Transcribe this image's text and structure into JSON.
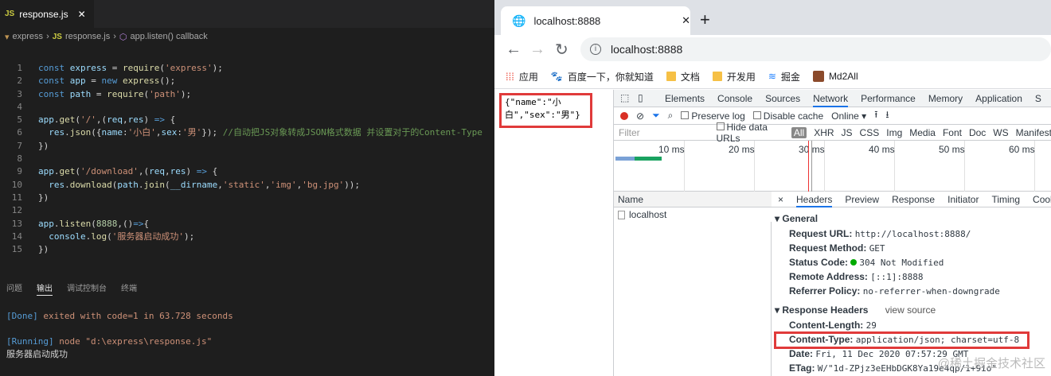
{
  "vscode": {
    "tab_label": "response.js",
    "breadcrumb": [
      "express",
      "response.js",
      "app.listen() callback"
    ],
    "code_lines": [
      {
        "n": "1",
        "html": [
          [
            "kw",
            "const "
          ],
          [
            "var",
            "express"
          ],
          [
            "pl",
            " = "
          ],
          [
            "fn",
            "require"
          ],
          [
            "pl",
            "("
          ],
          [
            "str",
            "'express'"
          ],
          [
            "pl",
            ");"
          ]
        ]
      },
      {
        "n": "2",
        "html": [
          [
            "kw",
            "const "
          ],
          [
            "var",
            "app"
          ],
          [
            "pl",
            " = "
          ],
          [
            "kw",
            "new "
          ],
          [
            "fn",
            "express"
          ],
          [
            "pl",
            "();"
          ]
        ]
      },
      {
        "n": "3",
        "html": [
          [
            "kw",
            "const "
          ],
          [
            "var",
            "path"
          ],
          [
            "pl",
            " = "
          ],
          [
            "fn",
            "require"
          ],
          [
            "pl",
            "("
          ],
          [
            "str",
            "'path'"
          ],
          [
            "pl",
            ");"
          ]
        ]
      },
      {
        "n": "4",
        "html": []
      },
      {
        "n": "5",
        "html": [
          [
            "var",
            "app"
          ],
          [
            "pl",
            "."
          ],
          [
            "fn",
            "get"
          ],
          [
            "pl",
            "("
          ],
          [
            "str",
            "'/'"
          ],
          [
            "pl",
            ",("
          ],
          [
            "var",
            "req"
          ],
          [
            "pl",
            ","
          ],
          [
            "var",
            "res"
          ],
          [
            "pl",
            ") "
          ],
          [
            "kw",
            "=>"
          ],
          [
            "pl",
            " {"
          ]
        ]
      },
      {
        "n": "6",
        "html": [
          [
            "pl",
            "  "
          ],
          [
            "var",
            "res"
          ],
          [
            "pl",
            "."
          ],
          [
            "fn",
            "json"
          ],
          [
            "pl",
            "({"
          ],
          [
            "var",
            "name"
          ],
          [
            "pl",
            ":"
          ],
          [
            "str",
            "'小白'"
          ],
          [
            "pl",
            ","
          ],
          [
            "var",
            "sex"
          ],
          [
            "pl",
            ":"
          ],
          [
            "str",
            "'男'"
          ],
          [
            "pl",
            "}); "
          ],
          [
            "cm",
            "//自动把JS对象转成JSON格式数据 并设置对于的Content-Type"
          ]
        ]
      },
      {
        "n": "7",
        "html": [
          [
            "pl",
            "})"
          ]
        ]
      },
      {
        "n": "8",
        "html": []
      },
      {
        "n": "9",
        "html": [
          [
            "var",
            "app"
          ],
          [
            "pl",
            "."
          ],
          [
            "fn",
            "get"
          ],
          [
            "pl",
            "("
          ],
          [
            "str",
            "'/download'"
          ],
          [
            "pl",
            ",("
          ],
          [
            "var",
            "req"
          ],
          [
            "pl",
            ","
          ],
          [
            "var",
            "res"
          ],
          [
            "pl",
            ") "
          ],
          [
            "kw",
            "=>"
          ],
          [
            "pl",
            " {"
          ]
        ]
      },
      {
        "n": "10",
        "html": [
          [
            "pl",
            "  "
          ],
          [
            "var",
            "res"
          ],
          [
            "pl",
            "."
          ],
          [
            "fn",
            "download"
          ],
          [
            "pl",
            "("
          ],
          [
            "var",
            "path"
          ],
          [
            "pl",
            "."
          ],
          [
            "fn",
            "join"
          ],
          [
            "pl",
            "("
          ],
          [
            "var",
            "__dirname"
          ],
          [
            "pl",
            ","
          ],
          [
            "str",
            "'static'"
          ],
          [
            "pl",
            ","
          ],
          [
            "str",
            "'img'"
          ],
          [
            "pl",
            ","
          ],
          [
            "str",
            "'bg.jpg'"
          ],
          [
            "pl",
            "));"
          ]
        ]
      },
      {
        "n": "11",
        "html": [
          [
            "pl",
            "})"
          ]
        ]
      },
      {
        "n": "12",
        "html": []
      },
      {
        "n": "13",
        "html": [
          [
            "var",
            "app"
          ],
          [
            "pl",
            "."
          ],
          [
            "fn",
            "listen"
          ],
          [
            "pl",
            "("
          ],
          [
            "num",
            "8888"
          ],
          [
            "pl",
            ",()"
          ],
          [
            "kw",
            "=>"
          ],
          [
            "pl",
            "{"
          ]
        ]
      },
      {
        "n": "14",
        "html": [
          [
            "pl",
            "  "
          ],
          [
            "var",
            "console"
          ],
          [
            "pl",
            "."
          ],
          [
            "fn",
            "log"
          ],
          [
            "pl",
            "("
          ],
          [
            "str",
            "'服务器启动成功'"
          ],
          [
            "pl",
            ");"
          ]
        ]
      },
      {
        "n": "15",
        "html": [
          [
            "pl",
            "})"
          ]
        ]
      }
    ],
    "panel_tabs": [
      "问题",
      "输出",
      "调试控制台",
      "终端"
    ],
    "output_done_prefix": "[Done]",
    "output_done_text": " exited with code=1 in 63.728 seconds",
    "output_running_prefix": "[Running]",
    "output_running_text": " node \"d:\\express\\response.js\"",
    "output_log": "服务器启动成功"
  },
  "chrome": {
    "tab_title": "localhost:8888",
    "new_tab": "+",
    "url": "localhost:8888",
    "bookmarks": [
      "应用",
      "百度一下，你就知道",
      "文档",
      "开发用",
      "掘金",
      "Md2All"
    ],
    "json_body": "{\"name\":\"小\n白\",\"sex\":\"男\"}"
  },
  "devtools": {
    "tabs": [
      "Elements",
      "Console",
      "Sources",
      "Network",
      "Performance",
      "Memory",
      "Application",
      "S"
    ],
    "preserve_log": "Preserve log",
    "disable_cache": "Disable cache",
    "throttle": "Online",
    "filter_placeholder": "Filter",
    "hide_data_urls": "Hide data URLs",
    "filter_types": [
      "All",
      "XHR",
      "JS",
      "CSS",
      "Img",
      "Media",
      "Font",
      "Doc",
      "WS",
      "Manifest"
    ],
    "timeline_ticks": [
      "10 ms",
      "20 ms",
      "30 ms",
      "40 ms",
      "50 ms",
      "60 ms"
    ],
    "name_header": "Name",
    "request_name": "localhost",
    "detail_close": "×",
    "detail_tabs": [
      "Headers",
      "Preview",
      "Response",
      "Initiator",
      "Timing",
      "Cookie"
    ],
    "general_title": "General",
    "general": [
      {
        "k": "Request URL:",
        "v": "http://localhost:8888/"
      },
      {
        "k": "Request Method:",
        "v": "GET"
      },
      {
        "k": "Status Code:",
        "v": "304 Not Modified"
      },
      {
        "k": "Remote Address:",
        "v": "[::1]:8888"
      },
      {
        "k": "Referrer Policy:",
        "v": "no-referrer-when-downgrade"
      }
    ],
    "response_title": "Response Headers",
    "view_source": "view source",
    "response": [
      {
        "k": "Content-Length:",
        "v": "29"
      },
      {
        "k": "Content-Type:",
        "v": "application/json; charset=utf-8"
      },
      {
        "k": "Date:",
        "v": "Fri, 11 Dec 2020 07:57:29 GMT"
      },
      {
        "k": "ETag:",
        "v": "W/\"1d-ZPjz3eEHbDGK8Ya19e4qp/1+9io\""
      }
    ],
    "watermark": "@稀土掘金技术社区"
  }
}
